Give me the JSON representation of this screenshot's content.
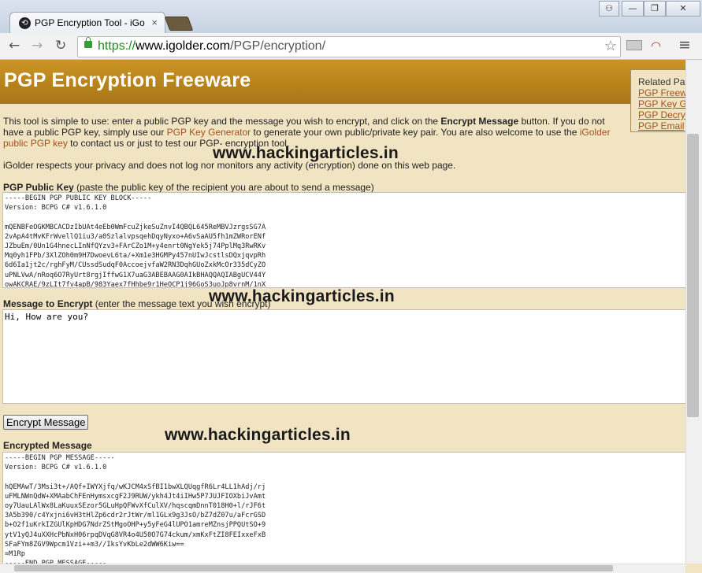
{
  "browser": {
    "tab_title": "PGP Encryption Tool - iGolder",
    "tab_close": "×",
    "url_scheme": "https://",
    "url_host": "www.igolder.com",
    "url_path": "/PGP/encryption/",
    "back_icon": "←",
    "forward_icon": "→",
    "reload_icon": "↻",
    "star_icon": "☆",
    "menu_icon": "≡",
    "window_user_icon": "⚇",
    "window_minimize": "—",
    "window_restore": "❐",
    "window_close": "✕"
  },
  "page": {
    "title": "PGP Encryption Freeware",
    "intro_1": "This tool is simple to use: enter a public PGP key and the message you wish to encrypt, and click on the ",
    "intro_bold": "Encrypt Message",
    "intro_2": " button.  If you do not have a public PGP key, simply use our ",
    "intro_link1": "PGP Key Generator",
    "intro_3": " to generate your own public/private key pair.  You are also welcome to use the ",
    "intro_link2": "iGolder public PGP key",
    "intro_4": " to contact us or just to test our PGP- encryption tool.",
    "privacy": "iGolder respects your privacy and does not log nor monitors any activity (encryption) done on this web page.",
    "public_key_label": "PGP Public Key",
    "public_key_hint": " (paste the public key of the recipient you are about to send a message)",
    "public_key_value": "-----BEGIN PGP PUBLIC KEY BLOCK-----\nVersion: BCPG C# v1.6.1.0\n\nmQENBFeOGKMBCACDzIbUAt4eEb0WmFcuZjkeSuZnvI4QBQL645ReMBVJzrgsSG7A\n2vApA4tMvKFrWvellQ1iu3/a0SzlalvpsqehDqyNyxo+A6vSaAU5fh1mZWRorENf\nJZbuEm/0Un1G4hnecLInNfQYzv3+FArCZo1M+y4enrt0NgYek5j74PplMq3RwRKv\nMq0yh1FPb/3XlZOh0m9H7DwoevL6ta/+Xm1e3HGMPy457nUIwJcstlsDQxjqvpRh\n6d6Ia1jt2c/rghFyM/CUssdSudqF0AccoejvfaW2RN3DqhGUoZxkMcOr335dCyZO\nuPNLVwA/nRoq6O7RyUrt8rgjIffwG1X7uaG3ABEBAAG0AIkBHAQQAQIABgUCV44Y\nowAKCRAE/9zLIt7fv4apB/983Yaex7fHhbe9r1HeOCP1j96GoS3uoJp8vrnM/1nX",
    "message_label": "Message to Encrypt",
    "message_hint": " (enter the message text you wish encrypt)",
    "message_value": "Hi, How are you?",
    "encrypt_button": "Encrypt Message",
    "encrypted_label": "Encrypted Message",
    "encrypted_value": "-----BEGIN PGP MESSAGE-----\nVersion: BCPG C# v1.6.1.0\n\nhQEMAwT/3Msi3t+/AQf+IWYXjfq/wKJCM4xSfBI1bwXLQUqgfR6Lr4LL1hAdj/rj\nuFMLNWnQdW+XMAabChFEnHymsxcgF2J9RUW/ykh4Jt4iIHw5P7JUJFIOXbiJvAmt\noy7UauLAlWx8LaKuuxSEzor5GLuHpQFWvXfCulXV/hqscqmDnnT018H0+l/rJF6t\n3A5b390/c4Yxjni6vH3tHlZp6cdr2rJtWr/ml1GLx9g3JsO/bZ7dZ07u/aFcrGSD\nb+O2f1uKrkIZGUlKpHDG7NdrZStMgoOHP+y5yFeG4lUPO1amreMZnsjPPQUtSO+9\nytV1yQJ4uXXHcPbNxH06rpqDVqG8VR4o4U50O7G74ckum/xmKxFtZI8FEIxxeFxB\nSFaFYm8ZGV9Wpcm1Vzi++m3//IksYvKbLe2dWW6Kiw==\n=M1Rp\n-----END PGP MESSAGE-----"
  },
  "related": {
    "heading": "Related Pa",
    "links": [
      "PGP Freew",
      "PGP Key G",
      "PGP Decry",
      "PGP Email"
    ]
  },
  "watermark": {
    "text": "www.hackingarticles.in"
  }
}
